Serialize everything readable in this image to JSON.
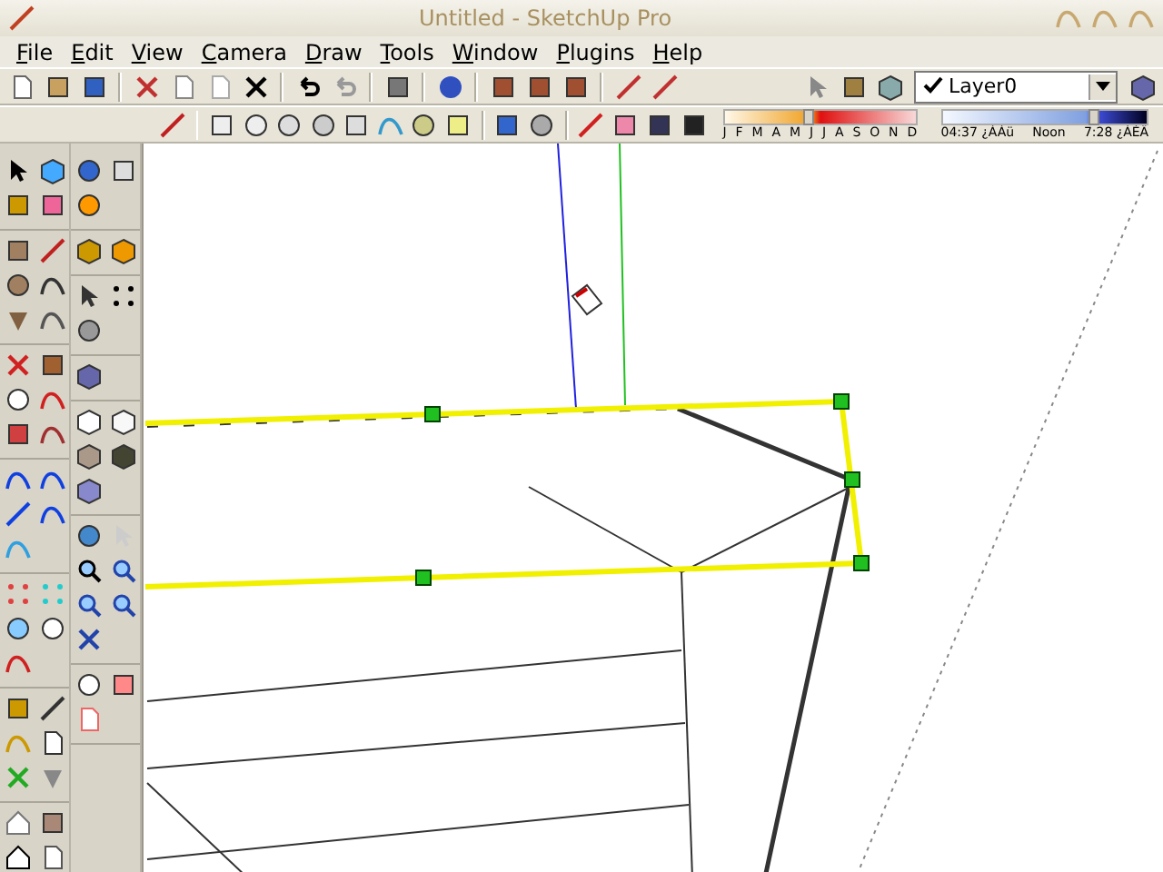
{
  "window": {
    "title": "Untitled - SketchUp Pro"
  },
  "menu": [
    "File",
    "Edit",
    "View",
    "Camera",
    "Draw",
    "Tools",
    "Window",
    "Plugins",
    "Help"
  ],
  "layer_select": {
    "value": "Layer0",
    "checked": true
  },
  "shadow_date": {
    "level": 0.44,
    "labels": [
      "J",
      "F",
      "M",
      "A",
      "M",
      "J",
      "J",
      "A",
      "S",
      "O",
      "N",
      "D"
    ]
  },
  "shadow_time": {
    "level": 0.74,
    "start": "04:37 ¿ÀÀü",
    "middle": "Noon",
    "end": "7:28 ¿ÀÈÄ"
  }
}
